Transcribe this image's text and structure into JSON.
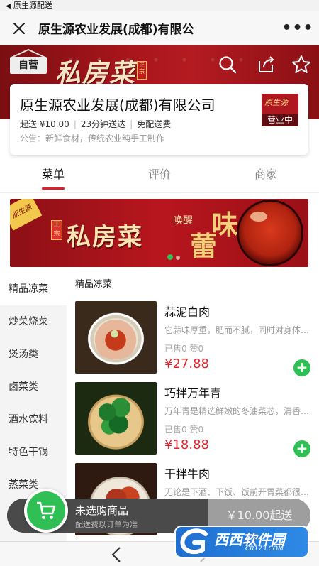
{
  "status_bar": {
    "back_app": "原生源配送"
  },
  "title_bar": {
    "title": "原生源农业发展(成都)有限公",
    "more": "•••"
  },
  "header": {
    "badge": "自营",
    "brand": "私房菜",
    "brand_seal": "正宗"
  },
  "shop": {
    "name": "原生源农业发展(成都)有限公司",
    "min_order": "起送 ¥10.00",
    "delivery_time": "23分钟送达",
    "delivery_fee": "免配送费",
    "notice": "公告：新鲜食材，传统农业纯手工制作",
    "logo_text": "原生源",
    "status": "营业中"
  },
  "tabs": [
    {
      "label": "菜单",
      "active": true
    },
    {
      "label": "评价",
      "active": false
    },
    {
      "label": "商家",
      "active": false
    }
  ],
  "promo": {
    "corner": "原生源",
    "seal": "正宗",
    "headline": "私房菜",
    "sub1": "唤醒",
    "sub2": "味",
    "sub3": "蕾"
  },
  "categories": [
    "精品凉菜",
    "炒菜烧菜",
    "煲汤类",
    "卤菜类",
    "酒水饮料",
    "特色干锅",
    "蒸菜类"
  ],
  "active_category": "精品凉菜",
  "section_title": "精品凉菜",
  "dishes": [
    {
      "name": "蒜泥白肉",
      "desc": "它蒜味厚重，肥而不腻，同时对身体有益",
      "sold": "已售0 赞0",
      "price": "¥27.88"
    },
    {
      "name": "巧拌万年青",
      "desc": "万年青是精选鲜嫩的冬油菜芯，清香爽口",
      "sold": "已售0 赞0",
      "price": "¥18.88"
    },
    {
      "name": "干拌牛肉",
      "desc": "无论是下酒、下饭、饭前开胃菜都很合适",
      "sold": "",
      "price": ""
    }
  ],
  "cart": {
    "empty_label": "未选购商品",
    "delivery_note": "配送费以订单为准",
    "checkout": "￥10.00起送"
  },
  "watermark": {
    "text": "西西软件园",
    "sub": "CR173.COM"
  },
  "colors": {
    "brand_red": "#b31b21",
    "accent_green": "#2fbf54",
    "price_red": "#e0262d"
  }
}
